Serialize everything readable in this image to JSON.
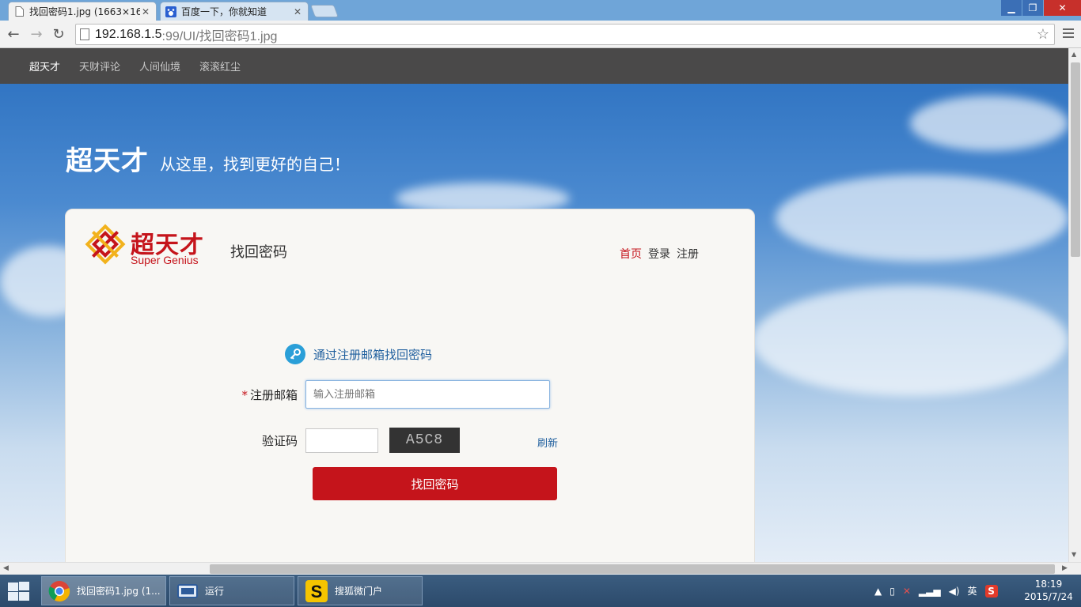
{
  "browser": {
    "tabs": [
      {
        "title": "找回密码1.jpg (1663×16",
        "active": true
      },
      {
        "title": "百度一下，你就知道",
        "active": false
      }
    ],
    "address": {
      "host": "192.168.1.5",
      "path": ":99/UI/找回密码1.jpg"
    }
  },
  "site_nav": {
    "items": [
      "超天才",
      "天财评论",
      "人间仙境",
      "滚滚红尘"
    ]
  },
  "hero": {
    "brand": "超天才",
    "slogan": "从这里，找到更好的自己！"
  },
  "card": {
    "logo_cn": "超天才",
    "logo_en": "Super Genius",
    "title": "找回密码",
    "links": {
      "home": "首页",
      "login": "登录",
      "register": "注册"
    },
    "method_label": "通过注册邮箱找回密码",
    "email_label": "注册邮箱",
    "required_mark": "*",
    "email_placeholder": "输入注册邮箱",
    "code_label": "验证码",
    "captcha_text": "A5C8",
    "refresh_label": "刷新",
    "submit_label": "找回密码"
  },
  "taskbar": {
    "items": [
      {
        "label": "找回密码1.jpg (1...",
        "icon": "chrome-icon"
      },
      {
        "label": "运行",
        "icon": "run-icon"
      },
      {
        "label": "搜狐微门户",
        "icon": "sohu-icon"
      }
    ],
    "ime": "英",
    "time": "18:19",
    "date": "2015/7/24"
  },
  "colors": {
    "brand_red": "#c5141b",
    "link_blue": "#1f5f9e",
    "nav_bg": "#4a4949"
  }
}
